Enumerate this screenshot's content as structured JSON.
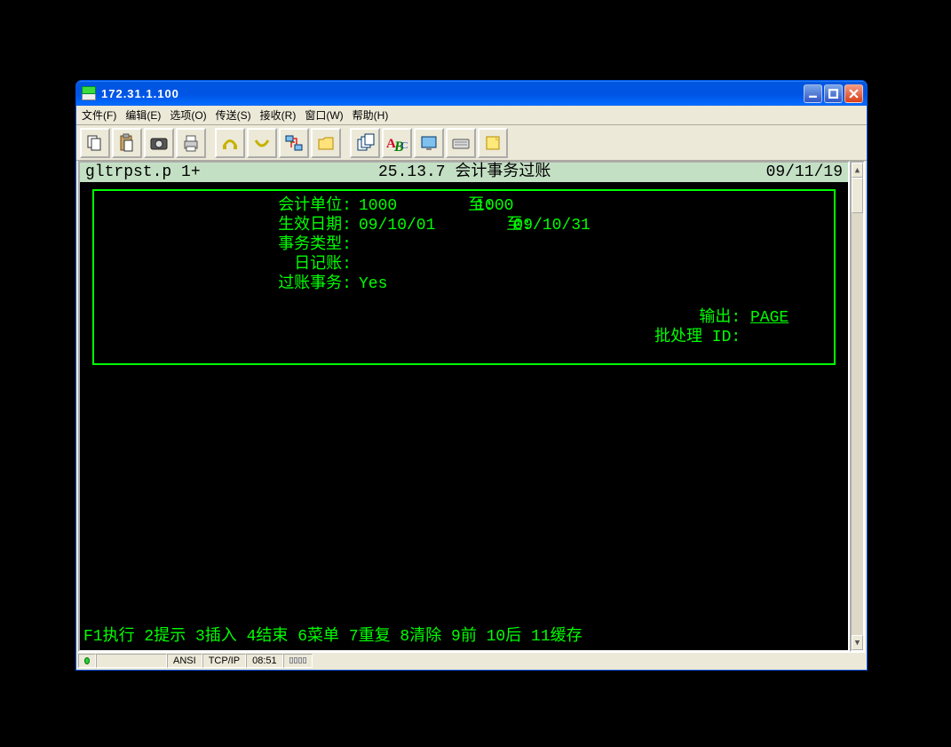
{
  "titlebar": {
    "title": "172.31.1.100"
  },
  "menu": {
    "file": "文件(F)",
    "edit": "编辑(E)",
    "options": "选项(O)",
    "transfer": "传送(S)",
    "receive": "接收(R)",
    "window": "窗口(W)",
    "help": "帮助(H)"
  },
  "term": {
    "header_left": "gltrpst.p 1+",
    "header_mid": "25.13.7 会计事务过账",
    "header_right": "09/11/19",
    "fields": {
      "entity_label": "会计单位:",
      "entity_from": "1000",
      "to_label": "至:",
      "entity_to": "1000",
      "eff_label": "生效日期:",
      "eff_from": "09/10/01",
      "eff_to": "09/10/31",
      "txtype_label": "事务类型:",
      "txtype_val": "",
      "journal_label": "日记账:",
      "journal_val": "",
      "post_label": "过账事务:",
      "post_val": "Yes",
      "output_label": "输出:",
      "output_val": "PAGE",
      "batch_label": "批处理 ID:",
      "batch_val": ""
    },
    "fnkeys": "F1执行 2提示 3插入 4结束 6菜单 7重复 8清除 9前 10后 11缓存"
  },
  "status": {
    "encoding": "ANSI",
    "proto": "TCP/IP",
    "time": "08:51"
  }
}
